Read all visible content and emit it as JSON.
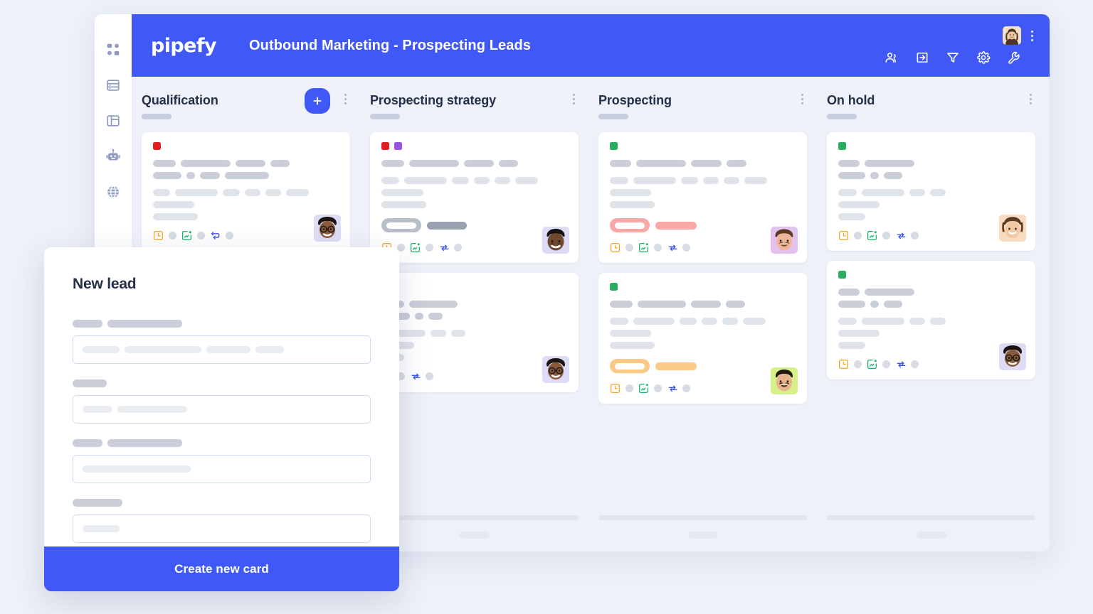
{
  "app": {
    "logo_text": "pipefy",
    "board_title": "Outbound Marketing - Prospecting Leads",
    "brand_color": "#3f58f6",
    "background_color": "#eef1f8"
  },
  "sidebar": {
    "items": [
      {
        "name": "dashboard-icon",
        "label": "Dashboard"
      },
      {
        "name": "database-icon",
        "label": "Database"
      },
      {
        "name": "layout-icon",
        "label": "Layout"
      },
      {
        "name": "robot-icon",
        "label": "Automations"
      },
      {
        "name": "globe-icon",
        "label": "Public form"
      }
    ]
  },
  "header": {
    "tools": [
      {
        "name": "members-icon",
        "label": "Members"
      },
      {
        "name": "import-icon",
        "label": "Import"
      },
      {
        "name": "filter-icon",
        "label": "Filter"
      },
      {
        "name": "gear-icon",
        "label": "Settings"
      },
      {
        "name": "wrench-icon",
        "label": "Tools"
      }
    ],
    "avatar_label": "User avatar",
    "menu_label": "More options"
  },
  "board": {
    "columns": [
      {
        "title": "Qualification",
        "has_add_button": true,
        "add_label": "+",
        "cards": [
          {
            "labels": [
              "#e02020"
            ],
            "badge": null,
            "avatar": "avatar-glasses-woman",
            "icons": [
              "clock-icon",
              "checklist-icon",
              "connection-icon"
            ]
          }
        ]
      },
      {
        "title": "Prospecting strategy",
        "has_add_button": false,
        "cards": [
          {
            "labels": [
              "#e02020",
              "#9b51e0"
            ],
            "badge": "#b9bfca",
            "avatar": "avatar-man-beard",
            "icons": [
              "clock-icon",
              "checklist-icon",
              "sync-icon"
            ]
          },
          {
            "labels": [],
            "badge": null,
            "avatar": "avatar-glasses-woman",
            "icons": [
              "checklist-icon",
              "sync-icon"
            ]
          }
        ]
      },
      {
        "title": "Prospecting",
        "has_add_button": false,
        "cards": [
          {
            "labels": [
              "#27ae60"
            ],
            "badge": "#f9a7a7",
            "avatar": "avatar-man-smiling",
            "icons": [
              "clock-icon",
              "checklist-icon",
              "sync-icon"
            ]
          },
          {
            "labels": [
              "#27ae60"
            ],
            "badge": "#fbc986",
            "avatar": "avatar-man-short-hair",
            "icons": [
              "clock-icon",
              "checklist-icon",
              "sync-icon"
            ]
          }
        ]
      },
      {
        "title": "On hold",
        "has_add_button": false,
        "cards": [
          {
            "labels": [
              "#27ae60"
            ],
            "badge": null,
            "avatar": "avatar-woman-smiling",
            "icons": [
              "clock-icon",
              "checklist-icon",
              "sync-icon"
            ]
          },
          {
            "labels": [
              "#27ae60"
            ],
            "badge": null,
            "avatar": "avatar-glasses-man",
            "icons": [
              "clock-icon",
              "checklist-icon",
              "sync-icon"
            ]
          }
        ]
      }
    ]
  },
  "modal": {
    "title": "New lead",
    "submit_label": "Create new card",
    "fields": [
      {
        "label_widths": [
          42,
          105
        ],
        "value_widths": [
          52,
          108,
          62,
          40
        ]
      },
      {
        "label_widths": [
          48
        ],
        "value_widths": [
          42,
          98
        ]
      },
      {
        "label_widths": [
          42,
          105
        ],
        "value_widths": [
          152
        ]
      },
      {
        "label_widths": [
          70
        ],
        "value_widths": [
          52
        ]
      }
    ]
  }
}
